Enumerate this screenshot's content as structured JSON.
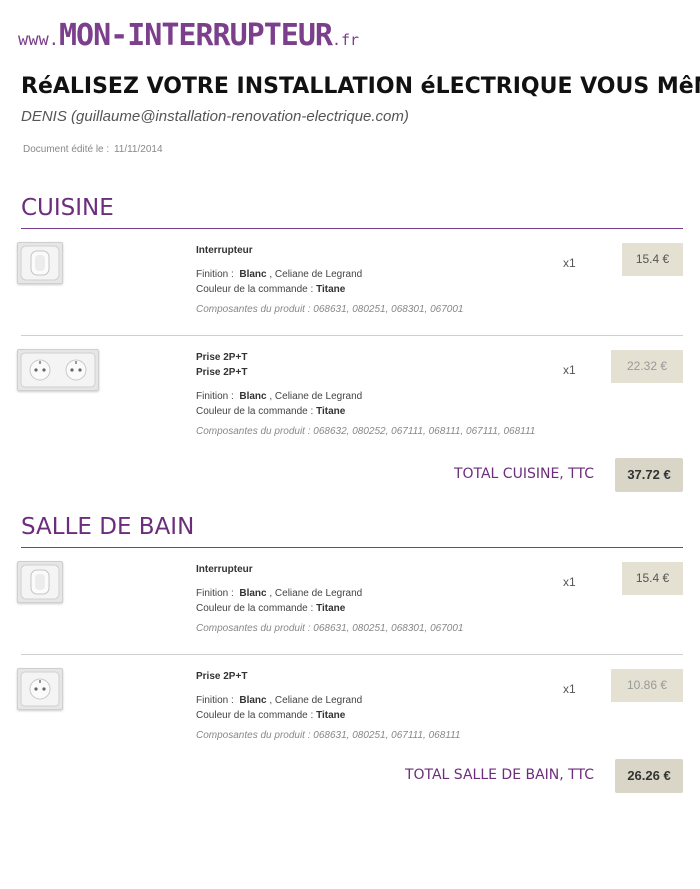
{
  "site": {
    "www": "www.",
    "main": "MON-INTERRUPTEUR",
    "tld": ".fr"
  },
  "title": "RéALISEZ VOTRE INSTALLATION éLECTRIQUE VOUS MêME",
  "user": "DENIS (guillaume@installation-renovation-electrique.com)",
  "doc_date_label": "Document édité le :",
  "doc_date": "11/11/2014",
  "labels": {
    "finition": "Finition :",
    "couleur": "Couleur de la commande :",
    "composantes": "Composantes du produit :"
  },
  "sections": [
    {
      "title": "CUISINE",
      "total_label": "TOTAL CUISINE, TTC",
      "total": "37.72 €",
      "items": [
        {
          "names": [
            "Interrupteur"
          ],
          "finition_bold": "Blanc",
          "finition_rest": ", Celiane de Legrand",
          "couleur": "Titane",
          "composantes": "068631, 080251, 068301, 067001",
          "qty": "x1",
          "price": "15.4 €",
          "thumb": "switch-icon"
        },
        {
          "names": [
            "Prise 2P+T",
            "Prise 2P+T"
          ],
          "finition_bold": "Blanc",
          "finition_rest": ", Celiane de Legrand",
          "couleur": "Titane",
          "composantes": "068632, 080252, 067111, 068111, 067111, 068111",
          "qty": "x1",
          "price": "22.32 €",
          "thumb": "double-socket-icon"
        }
      ]
    },
    {
      "title": "SALLE DE BAIN",
      "total_label": "TOTAL SALLE DE BAIN, TTC",
      "total": "26.26 €",
      "items": [
        {
          "names": [
            "Interrupteur"
          ],
          "finition_bold": "Blanc",
          "finition_rest": ", Celiane de Legrand",
          "couleur": "Titane",
          "composantes": "068631, 080251, 068301, 067001",
          "qty": "x1",
          "price": "15.4 €",
          "thumb": "switch-icon"
        },
        {
          "names": [
            "Prise 2P+T"
          ],
          "finition_bold": "Blanc",
          "finition_rest": ", Celiane de Legrand",
          "couleur": "Titane",
          "composantes": "068631, 080251, 067111, 068111",
          "qty": "x1",
          "price": "10.86 €",
          "thumb": "socket-icon"
        }
      ]
    }
  ]
}
